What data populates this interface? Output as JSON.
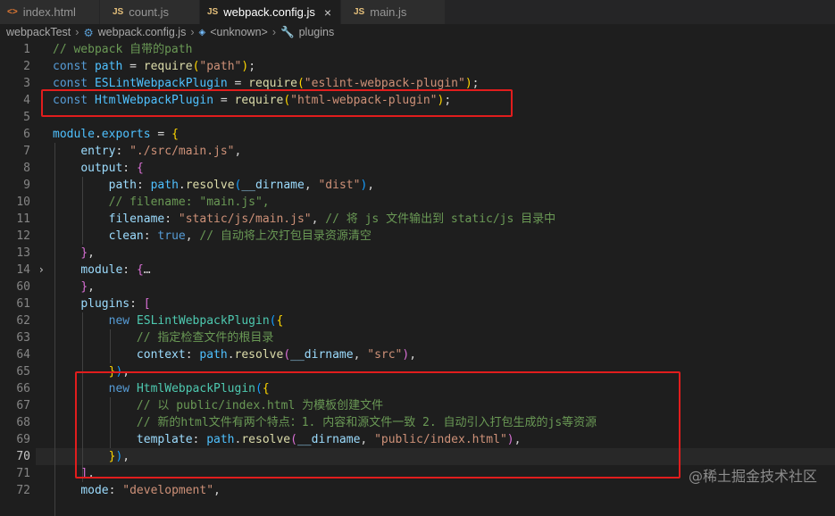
{
  "tabs": [
    {
      "label": "index.html",
      "icon": "html-file-icon",
      "badge": ""
    },
    {
      "label": "count.js",
      "icon": "js-file-icon",
      "badge": "JS"
    },
    {
      "label": "webpack.config.js",
      "icon": "js-file-icon",
      "badge": "JS",
      "active": true
    },
    {
      "label": "main.js",
      "icon": "js-file-icon",
      "badge": "JS"
    }
  ],
  "close_glyph": "×",
  "breadcrumb": {
    "folder": "webpackTest",
    "file": "webpack.config.js",
    "scope": "<unknown>",
    "symbol": "plugins"
  },
  "lines": [
    {
      "n": "1",
      "text": "// webpack 自带的path"
    },
    {
      "n": "2",
      "text": "const path = require(\"path\");"
    },
    {
      "n": "3",
      "text": "const ESLintWebpackPlugin = require(\"eslint-webpack-plugin\");"
    },
    {
      "n": "4",
      "text": "const HtmlWebpackPlugin = require(\"html-webpack-plugin\");"
    },
    {
      "n": "5",
      "text": ""
    },
    {
      "n": "6",
      "text": "module.exports = {"
    },
    {
      "n": "7",
      "text": "    entry: \"./src/main.js\","
    },
    {
      "n": "8",
      "text": "    output: {"
    },
    {
      "n": "9",
      "text": "        path: path.resolve(__dirname, \"dist\"),"
    },
    {
      "n": "10",
      "text": "        // filename: \"main.js\","
    },
    {
      "n": "11",
      "text": "        filename: \"static/js/main.js\", // 将 js 文件输出到 static/js 目录中"
    },
    {
      "n": "12",
      "text": "        clean: true, // 自动将上次打包目录资源清空"
    },
    {
      "n": "13",
      "text": "    },"
    },
    {
      "n": "14",
      "text": "    module: {…"
    },
    {
      "n": "60",
      "text": "    },"
    },
    {
      "n": "61",
      "text": "    plugins: ["
    },
    {
      "n": "62",
      "text": "        new ESLintWebpackPlugin({"
    },
    {
      "n": "63",
      "text": "            // 指定检查文件的根目录"
    },
    {
      "n": "64",
      "text": "            context: path.resolve(__dirname, \"src\"),"
    },
    {
      "n": "65",
      "text": "        }),"
    },
    {
      "n": "66",
      "text": "        new HtmlWebpackPlugin({"
    },
    {
      "n": "67",
      "text": "            // 以 public/index.html 为模板创建文件"
    },
    {
      "n": "68",
      "text": "            // 新的html文件有两个特点：1. 内容和源文件一致 2. 自动引入打包生成的js等资源"
    },
    {
      "n": "69",
      "text": "            template: path.resolve(__dirname, \"public/index.html\"),"
    },
    {
      "n": "70",
      "text": "        }),"
    },
    {
      "n": "71",
      "text": "    ],"
    },
    {
      "n": "72",
      "text": "    mode: \"development\","
    }
  ],
  "watermark": "@稀土掘金技术社区",
  "colors": {
    "editor_bg": "#1e1e1e",
    "comment": "#6a9955",
    "keyword": "#569cd6",
    "string": "#ce9178",
    "property": "#9cdcfe",
    "highlight_box": "#e11d1d"
  }
}
